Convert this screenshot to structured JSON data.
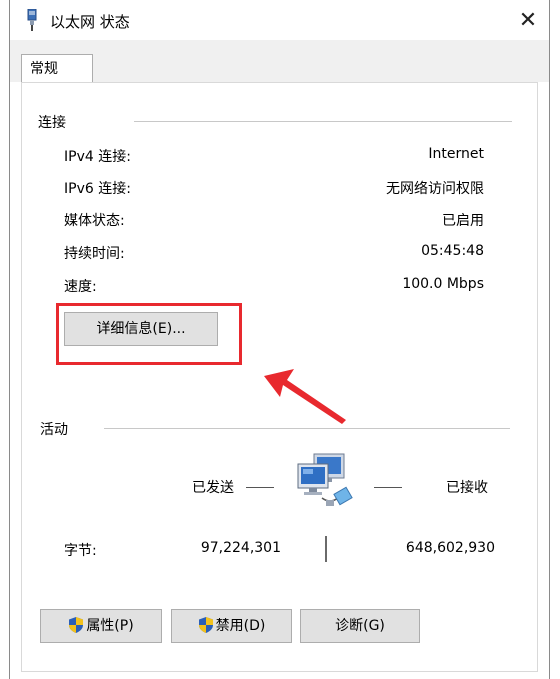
{
  "window": {
    "title": "以太网 状态",
    "close_glyph": "✕",
    "tab": "常规"
  },
  "connection": {
    "title": "连接",
    "rows": [
      {
        "label": "IPv4 连接:",
        "value": "Internet"
      },
      {
        "label": "IPv6 连接:",
        "value": "无网络访问权限"
      },
      {
        "label": "媒体状态:",
        "value": "已启用"
      },
      {
        "label": "持续时间:",
        "value": "05:45:48"
      },
      {
        "label": "速度:",
        "value": "100.0 Mbps"
      }
    ],
    "details_button": "详细信息(E)..."
  },
  "activity": {
    "title": "活动",
    "sent_label": "已发送",
    "received_label": "已接收",
    "bytes_label": "字节:",
    "bytes_sent": "97,224,301",
    "bytes_received": "648,602,930"
  },
  "buttons": {
    "properties": "属性(P)",
    "disable": "禁用(D)",
    "diagnose": "诊断(G)"
  },
  "colors": {
    "annotation": "#e8292e",
    "button_bg": "#e1e1e1",
    "shield_blue": "#2a5fb8",
    "shield_yellow": "#f2c11c"
  }
}
